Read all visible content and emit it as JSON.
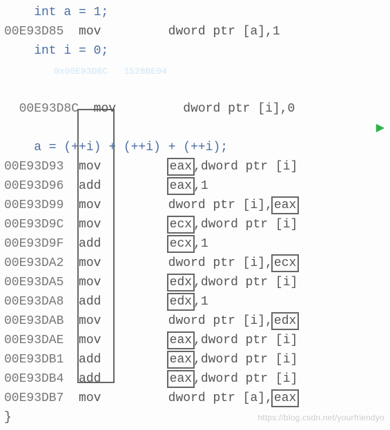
{
  "src": {
    "decl_a": "    int a = 1;",
    "decl_i": "    int i = 0;",
    "expr": "    a = (++i) + (++i) + (++i);",
    "close": "}"
  },
  "arrow_glyph": "▶",
  "ghost_hint": "0x00E93D8C   1528BE04",
  "watermark": "https://blog.csdn.net/yourfriendyo",
  "asm": {
    "l0": {
      "addr": "00E93D85",
      "mn": "mov",
      "rest_a": "dword ptr [a],1"
    },
    "l1": {
      "addr": "00E93D8C",
      "mn": "mov",
      "rest_a": "dword ptr [i],0"
    },
    "l2": {
      "addr": "00E93D93",
      "mn": "mov",
      "reg": "eax",
      "sep": ",",
      "rest_b": "dword ptr [i]"
    },
    "l3": {
      "addr": "00E93D96",
      "mn": "add",
      "reg": "eax",
      "sep": ",",
      "rest_b": "1"
    },
    "l4": {
      "addr": "00E93D99",
      "mn": "mov",
      "pre": "dword ptr [i],",
      "reg2": "eax"
    },
    "l5": {
      "addr": "00E93D9C",
      "mn": "mov",
      "reg": "ecx",
      "sep": ",",
      "rest_b": "dword ptr [i]"
    },
    "l6": {
      "addr": "00E93D9F",
      "mn": "add",
      "reg": "ecx",
      "sep": ",",
      "rest_b": "1"
    },
    "l7": {
      "addr": "00E93DA2",
      "mn": "mov",
      "pre": "dword ptr [i],",
      "reg2": "ecx"
    },
    "l8": {
      "addr": "00E93DA5",
      "mn": "mov",
      "reg": "edx",
      "sep": ",",
      "rest_b": "dword ptr [i]"
    },
    "l9": {
      "addr": "00E93DA8",
      "mn": "add",
      "reg": "edx",
      "sep": ",",
      "rest_b": "1"
    },
    "l10": {
      "addr": "00E93DAB",
      "mn": "mov",
      "pre": "dword ptr [i],",
      "reg2": "edx"
    },
    "l11": {
      "addr": "00E93DAE",
      "mn": "mov",
      "reg": "eax",
      "sep": ",",
      "rest_b": "dword ptr [i]"
    },
    "l12": {
      "addr": "00E93DB1",
      "mn": "add",
      "reg": "eax",
      "sep": ",",
      "rest_b": "dword ptr [i]"
    },
    "l13": {
      "addr": "00E93DB4",
      "mn": "add",
      "reg": "eax",
      "sep": ",",
      "rest_b": "dword ptr [i]"
    },
    "l14": {
      "addr": "00E93DB7",
      "mn": "mov",
      "pre": "dword ptr [a],",
      "reg2": "eax"
    }
  }
}
